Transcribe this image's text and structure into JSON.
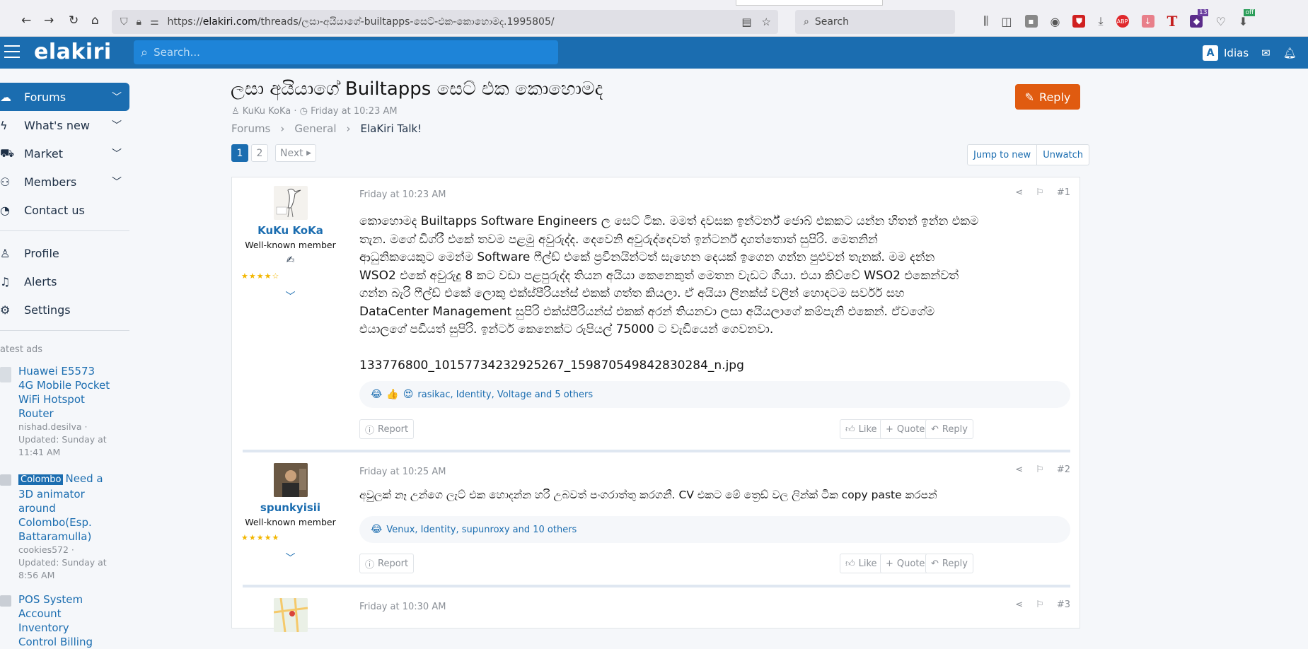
{
  "browser": {
    "url_prefix": "https://",
    "url_domain": "elakiri.com",
    "url_path": "/threads/ලසා-අයියාගේ-builtapps-සෙට්-එක-කොහොමද.1995805/",
    "search_placeholder": "Search",
    "ext_badge_count": "13",
    "ext_badge_off": "off"
  },
  "site": {
    "logo": "elakiri",
    "search_placeholder": "Search...",
    "user_name": "Idias",
    "user_initial": "A"
  },
  "sidebar": {
    "items": [
      {
        "label": "Forums",
        "icon": "speech-icon"
      },
      {
        "label": "What's new",
        "icon": "bolt-icon"
      },
      {
        "label": "Market",
        "icon": "cart-icon"
      },
      {
        "label": "Members",
        "icon": "users-icon"
      },
      {
        "label": "Contact us",
        "icon": "contact-icon"
      },
      {
        "label": "Profile",
        "icon": "person-icon"
      },
      {
        "label": "Alerts",
        "icon": "bell-icon"
      },
      {
        "label": "Settings",
        "icon": "gear-icon"
      }
    ],
    "latest_title": "atest ads",
    "ads": [
      {
        "title": "Huawei E5573 4G Mobile Pocket WiFi Hotspot Router",
        "meta_user": "nishad.desilva ·",
        "meta_updated": "Updated: Sunday at 11:41 AM"
      },
      {
        "tag": "Colombo",
        "title": "Need a 3D animator around Colombo(Esp. Battaramulla)",
        "meta_user": "cookies572 ·",
        "meta_updated": "Updated: Sunday at 8:56 AM"
      },
      {
        "title": "POS System Account Inventory Control Billing"
      }
    ]
  },
  "thread": {
    "title": "ලසා අයියාගේ Builtapps සෙට් එක කොහොමද",
    "author": "KuKu KoKa",
    "date": "Friday at 10:23 AM",
    "reply_label": "Reply",
    "breadcrumb": [
      "Forums",
      "General",
      "ElaKiri Talk!"
    ],
    "pages": [
      "1",
      "2"
    ],
    "next_label": "Next",
    "jump_label": "Jump to new",
    "unwatch_label": "Unwatch"
  },
  "posts": [
    {
      "author": "KuKu KoKa",
      "role": "Well-known member",
      "stars": "★★★★☆",
      "date": "Friday at 10:23 AM",
      "num": "#1",
      "body_lines": [
        "කොහොමද Builtapps Software Engineers ල සෙට් ටික. මමත් දවසක ඉන්ටර්න් ජොබ් එකකට යන්න හිතන් ඉන්න එකම",
        "තැන. මගේ ඩිග්රී එකේ තවම පළමු අවුරුද්ද. දෙවෙනි අවුරුද්දෙවත් ඉන්ටර්න් දාගත්තොත් සුපිරි. මෙතනින්",
        "ආධුනිකයෙකුට මෙන්ම Software ෆීල්ඩ් එකේ ප්‍රවීනයින්ටත් සැහෙන දෙයක් ඉගෙන ගන්න පුළුවන් තැනක්. මම දන්න",
        "WSO2 එකේ අවුරුදු 8 කට වඩා පළපුරුද්ද තියන අයියා කෙනෙකුත් මෙතන වැඩට ගියා. එයා කිව්වේ WSO2 එකෙන්වත්",
        "ගන්න බැරි ෆීල්ඩ් එකේ ලොකු එක්ස්පීරියන්ස් එකක් ගත්ත කියලා. ඒ අයියා ලිනක්ස් වලින් හොදටම සර්වර් සහ",
        "DataCenter Management සුපිරි එක්ස්පීරියන්ස් එකක් අරන් තියනවා ලසා අයියලාගේ කම්පැනි එකෙන්. ඒවගේම",
        "එයාලගේ පඩියත් සුපිරි. ඉන්ටර් කෙනෙක්ට රුපියල් 75000 ට වැඩියෙන් ගෙවනවා."
      ],
      "attachment": "133776800_10157734232925267_159870549842830284_n.jpg",
      "reactions_text": "rasikac, Identity, Voltage and 5 others",
      "report": "Report",
      "like": "Like",
      "quote": "Quote",
      "reply": "Reply"
    },
    {
      "author": "spunkyisii",
      "role": "Well-known member",
      "stars": "★★★★★",
      "date": "Friday at 10:25 AM",
      "num": "#2",
      "body_lines": [
        "අවුලක් නෑ උන්ගෙ ලැට් එක හොදන්න හරි උබවත් පංගරාත්තු කරගනී. CV එකට මේ ත්‍රෙඩ් වල ලින්ක් ටික copy paste කරපන්"
      ],
      "reactions_text": "Venux, Identity, supunroxy and 10 others",
      "report": "Report",
      "like": "Like",
      "quote": "Quote",
      "reply": "Reply"
    },
    {
      "date": "Friday at 10:30 AM",
      "num": "#3"
    }
  ]
}
